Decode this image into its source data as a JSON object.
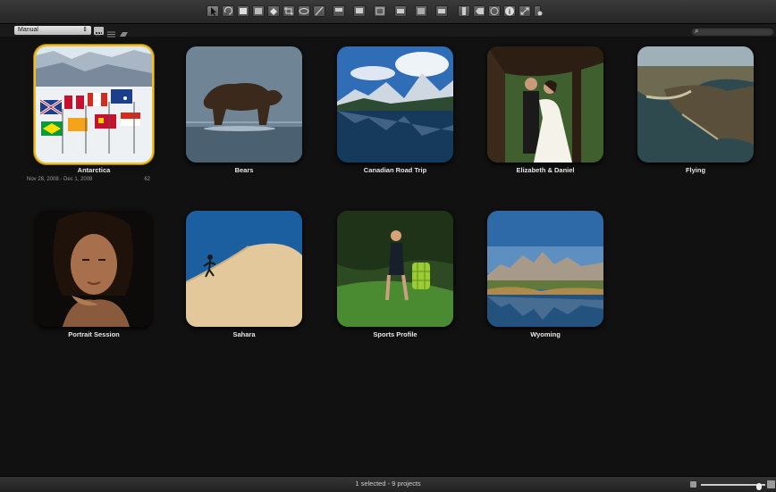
{
  "toolbar": {
    "tools": [
      "pointer-tool-icon",
      "rotate-tool-icon",
      "stack-tool-icon",
      "lift-tool-icon",
      "stamp-tool-icon",
      "crop-tool-icon",
      "redeye-tool-icon",
      "straighten-tool-icon",
      "view-single-icon",
      "view-multi-icon",
      "view-compare-icon",
      "view-split-icon",
      "view-full-icon",
      "view-strip-icon",
      "badge-icon",
      "tag-icon",
      "circle-icon",
      "info-icon",
      "fullscreen-icon",
      "adjust-icon"
    ]
  },
  "subbar": {
    "sort_value": "Manual",
    "search_placeholder": ""
  },
  "projects": [
    {
      "title": "Antarctica",
      "dates": "Nov 28, 2008 - Dec 1, 2008",
      "count": "62",
      "selected": true
    },
    {
      "title": "Bears"
    },
    {
      "title": "Canadian Road Trip"
    },
    {
      "title": "Elizabeth & Daniel"
    },
    {
      "title": "Flying"
    },
    {
      "title": "Portrait Session"
    },
    {
      "title": "Sahara"
    },
    {
      "title": "Sports Profile"
    },
    {
      "title": "Wyoming"
    }
  ],
  "status": {
    "text": "1 selected - 9 projects"
  },
  "colors": {
    "selection": "#f0c020",
    "background": "#111111"
  }
}
